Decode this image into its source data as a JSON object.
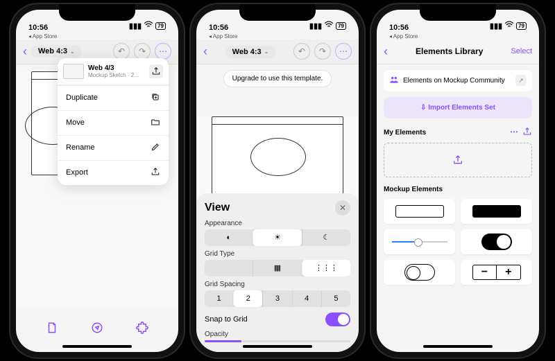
{
  "status": {
    "time": "10:56",
    "breadcrumb": "◂ App Store",
    "battery": "79"
  },
  "phone1": {
    "doc_title": "Web 4:3",
    "dropdown": {
      "title": "Web 4/3",
      "subtitle": "Mockup Sketch · 2…",
      "items": [
        {
          "label": "Duplicate",
          "icon": "⊕"
        },
        {
          "label": "Move",
          "icon": "▭"
        },
        {
          "label": "Rename",
          "icon": "✎"
        },
        {
          "label": "Export",
          "icon": "⇪"
        }
      ]
    }
  },
  "phone2": {
    "doc_title": "Web 4:3",
    "banner": "Upgrade to use this template.",
    "panel": {
      "title": "View",
      "appearance_label": "Appearance",
      "appearance_opts": [
        "◐",
        "☀",
        "☾"
      ],
      "appearance_active": 1,
      "grid_label": "Grid Type",
      "grid_opts": [
        "",
        "▦",
        "⋮⋮⋮"
      ],
      "grid_active": 2,
      "spacing_label": "Grid Spacing",
      "spacing_opts": [
        "1",
        "2",
        "3",
        "4",
        "5"
      ],
      "spacing_active": 1,
      "snap_label": "Snap to Grid",
      "snap_on": true,
      "opacity_label": "Opacity"
    }
  },
  "phone3": {
    "title": "Elements Library",
    "select": "Select",
    "community": "Elements on Mockup Community",
    "import": "⇩ Import Elements Set",
    "my_elements": "My Elements",
    "mockup_elements": "Mockup Elements"
  }
}
